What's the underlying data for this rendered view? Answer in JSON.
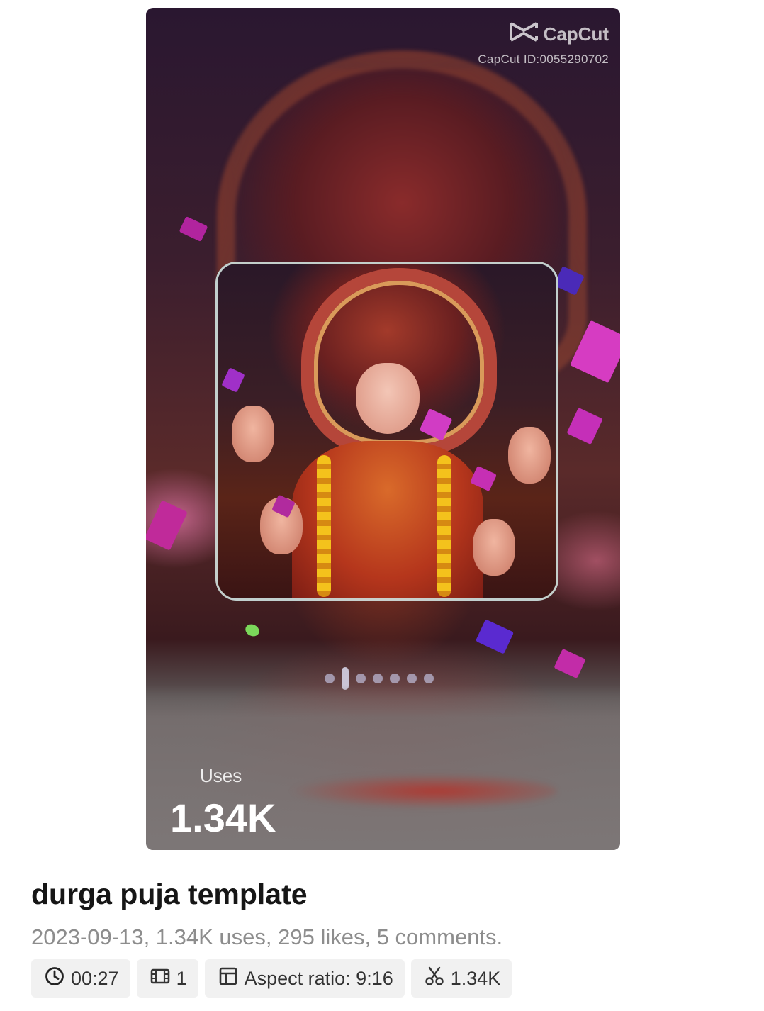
{
  "preview": {
    "watermark_brand": "CapCut",
    "watermark_id": "CapCut ID:0055290702",
    "uses_label": "Uses",
    "uses_value": "1.34K",
    "page_count": 7,
    "current_page": 2
  },
  "template": {
    "title": "durga puja template",
    "meta": "2023-09-13, 1.34K uses, 295 likes, 5 comments."
  },
  "chips": {
    "duration": "00:27",
    "clips": "1",
    "aspect_ratio": "Aspect ratio: 9:16",
    "uses": "1.34K"
  },
  "icons": {
    "duration": "clock-icon",
    "clips": "film-icon",
    "aspect_ratio": "layout-icon",
    "uses": "scissors-icon"
  }
}
